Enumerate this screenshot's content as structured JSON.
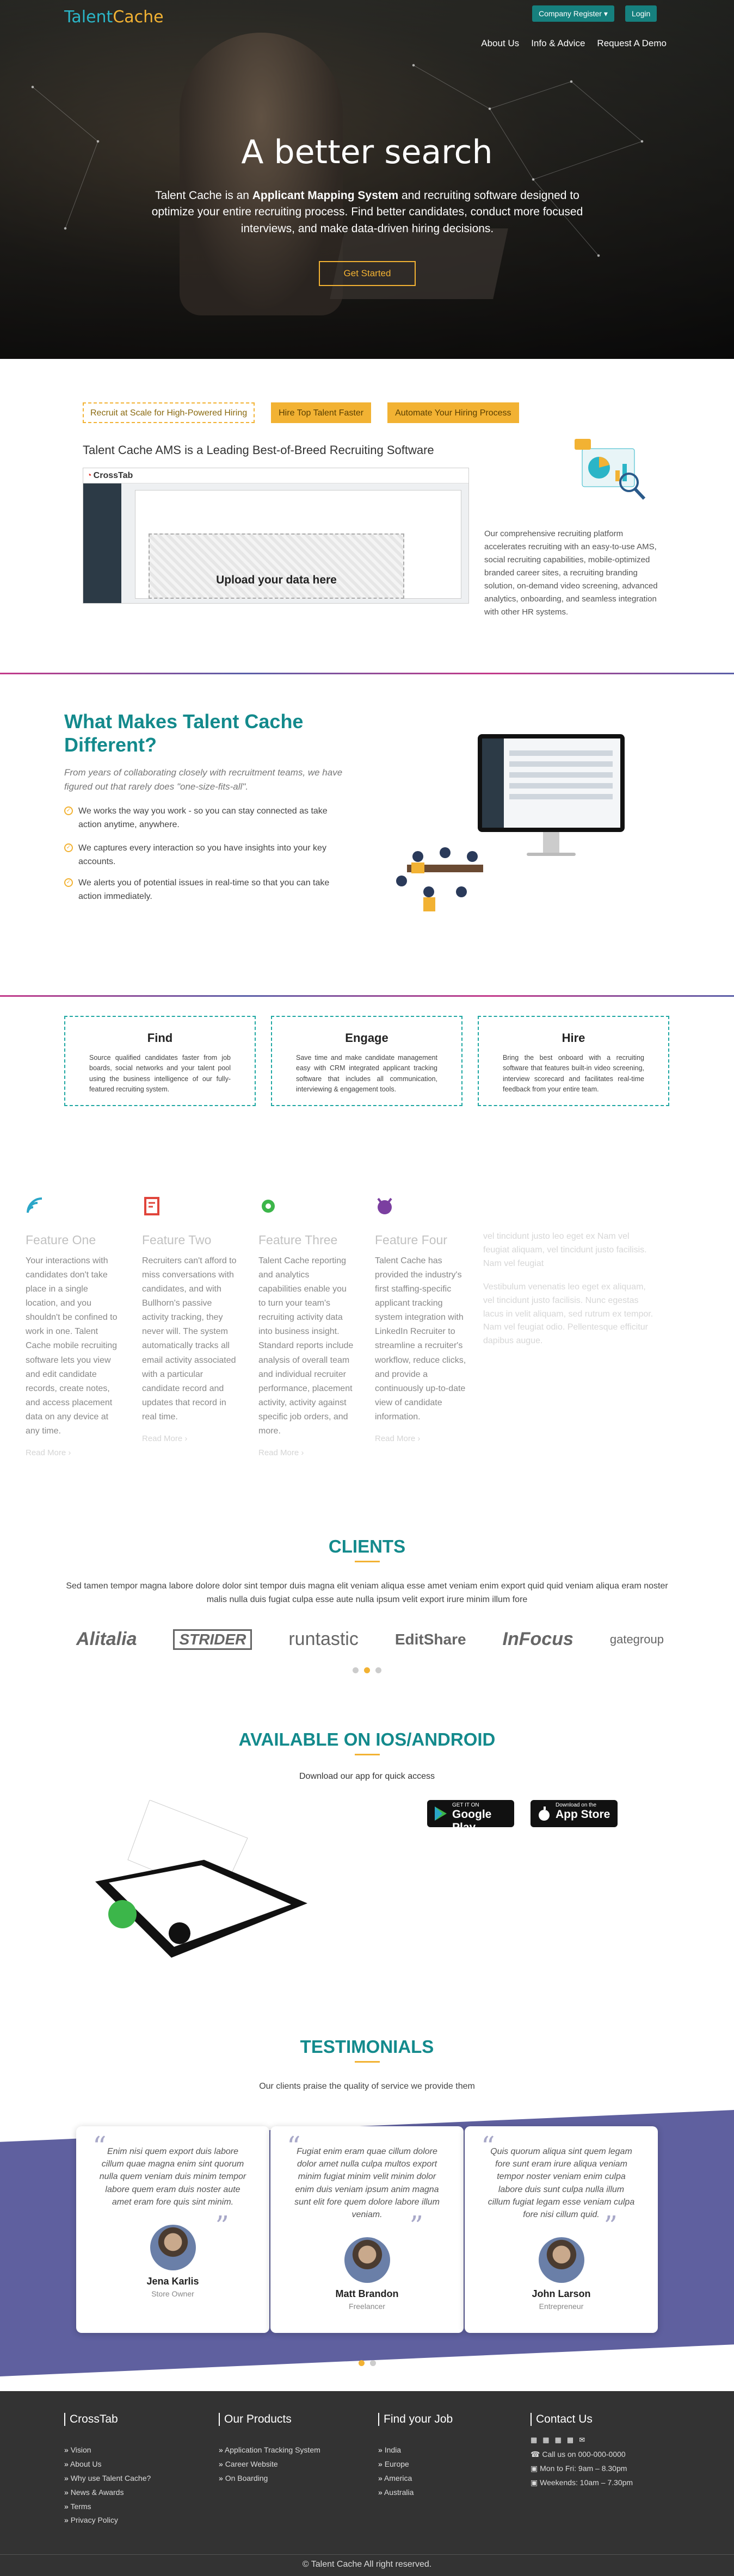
{
  "header": {
    "logo_part1": "Talent",
    "logo_part2": "Cache",
    "register_label": "Company Register ▾",
    "login_label": "Login",
    "nav": [
      "About Us",
      "Info & Advice",
      "Request A Demo"
    ]
  },
  "hero": {
    "title": "A better search",
    "sub_pre": "Talent Cache is an ",
    "sub_bold": "Applicant Mapping System",
    "sub_post": " and recruiting software designed to optimize your entire recruiting process. Find better candidates, conduct more focused interviews, and make data-driven hiring decisions.",
    "cta": "Get Started"
  },
  "pills": [
    "Recruit at Scale for High-Powered Hiring",
    "Hire Top Talent Faster",
    "Automate Your Hiring Process"
  ],
  "ams": {
    "title": "Talent Cache AMS is a Leading Best-of-Breed Recruiting Software",
    "app_name": "CrossTab",
    "upload": "Upload your data here",
    "description": "Our comprehensive recruiting platform accelerates recruiting with an easy-to-use AMS, social recruiting capabilities, mobile-optimized branded career sites, a recruiting branding solution, on-demand video screening, advanced analytics, onboarding, and seamless integration with other HR systems."
  },
  "different": {
    "title": "What Makes Talent Cache Different?",
    "intro": "From years of collaborating closely with recruitment teams, we have figured out that rarely does \"one-size-fits-all\".",
    "points": [
      "We works the way you work - so you can stay connected as take action anytime, anywhere.",
      "We captures every interaction so you have insights into your key accounts.",
      "We alerts you of potential issues in real-time so that you can take action immediately."
    ]
  },
  "cards": [
    {
      "title": "Find",
      "text": "Source qualified candidates faster from job boards, social networks and your talent pool using the business intelligence of our fully-featured recruiting system."
    },
    {
      "title": "Engage",
      "text": "Save time and make candidate management easy with CRM integrated applicant tracking software that includes all communication, interviewing & engagement tools."
    },
    {
      "title": "Hire",
      "text": "Bring the best onboard with a recruiting software that features built-in video screening, interview scorecard and facilitates real-time feedback from your entire team."
    }
  ],
  "features": [
    {
      "title": "Feature One",
      "text": "Your interactions with candidates don't take place in a single location, and you shouldn't be confined to work in one. Talent Cache mobile recruiting software lets you view and edit candidate records, create notes, and access placement data on any device at any time.",
      "more": "Read More ›",
      "color": "#2aa6c8"
    },
    {
      "title": "Feature Two",
      "text": "Recruiters can't afford to miss conversations with candidates, and with Bullhorn's passive activity tracking, they never will. The system automatically tracks all email activity associated with a particular candidate record and updates that record in real time.",
      "more": "Read More ›",
      "color": "#e0443a"
    },
    {
      "title": "Feature Three",
      "text": "Talent Cache reporting and analytics capabilities enable you to turn your team's recruiting activity data into business insight. Standard reports include analysis of overall team and individual recruiter performance, placement activity, activity against specific job orders, and more.",
      "more": "Read More ›",
      "color": "#3cb64a"
    },
    {
      "title": "Feature Four",
      "text": "Talent Cache has provided the industry's first staffing-specific applicant tracking system integration with LinkedIn Recruiter to streamline a recruiter's workflow, reduce clicks, and provide a continuously up-to-date view of candidate information.",
      "more": "Read More ›",
      "color": "#7b3fa0"
    }
  ],
  "faded": [
    "vel tincidunt justo leo eget ex Nam vel feugiat aliquam, vel tincidunt justo facilisis. Nam vel feugiat",
    "Vestibulum venenatis leo eget ex aliquam, vel tincidunt justo facilisis. Nunc egestas lacus in velit aliquam, sed rutrum ex tempor. Nam vel feugiat odio. Pellentesque efficitur dapibus augue."
  ],
  "clients": {
    "title": "CLIENTS",
    "text": "Sed tamen tempor magna labore dolore dolor sint tempor duis magna elit veniam aliqua esse amet veniam enim export quid quid veniam aliqua eram noster malis nulla duis fugiat culpa esse aute nulla ipsum velit export irure minim illum fore",
    "logos": [
      "Alitalia",
      "STRIDER",
      "runtastic",
      "EditShare",
      "InFocus",
      "gategroup"
    ]
  },
  "app": {
    "title": "AVAILABLE ON IOS/ANDROID",
    "text": "Download our app for quick access",
    "google_small": "GET IT ON",
    "google_big": "Google Play",
    "apple_small": "Download on the",
    "apple_big": "App Store"
  },
  "testimonials": {
    "title": "TESTIMONIALS",
    "text": "Our clients praise the quality of service we provide them",
    "items": [
      {
        "quote": "Enim nisi quem export duis labore cillum quae magna enim sint quorum nulla quem veniam duis minim tempor labore quem eram duis noster aute amet eram fore quis sint minim.",
        "name": "Jena Karlis",
        "role": "Store Owner"
      },
      {
        "quote": "Fugiat enim eram quae cillum dolore dolor amet nulla culpa multos export minim fugiat minim velit minim dolor enim duis veniam ipsum anim magna sunt elit fore quem dolore labore illum veniam.",
        "name": "Matt Brandon",
        "role": "Freelancer"
      },
      {
        "quote": "Quis quorum aliqua sint quem legam fore sunt eram irure aliqua veniam tempor noster veniam enim culpa labore duis sunt culpa nulla illum cillum fugiat legam esse veniam culpa fore nisi cillum quid.",
        "name": "John Larson",
        "role": "Entrepreneur"
      }
    ]
  },
  "footer": {
    "col1_title": "CrossTab",
    "col1": [
      "Vision",
      "About Us",
      "Why use Talent Cache?",
      "News & Awards",
      "Terms",
      "Privacy Policy"
    ],
    "col2_title": "Our Products",
    "col2": [
      "Application Tracking System",
      "Career Website",
      "On Boarding"
    ],
    "col3_title": "Find your Job",
    "col3": [
      "India",
      "Europe",
      "America",
      "Australia"
    ],
    "col4_title": "Contact Us",
    "col4": [
      "Call us on 000-000-0000",
      "Mon to Fri: 9am – 8.30pm",
      "Weekends: 10am – 7.30pm"
    ],
    "copyright": "© Talent Cache  All right reserved."
  }
}
